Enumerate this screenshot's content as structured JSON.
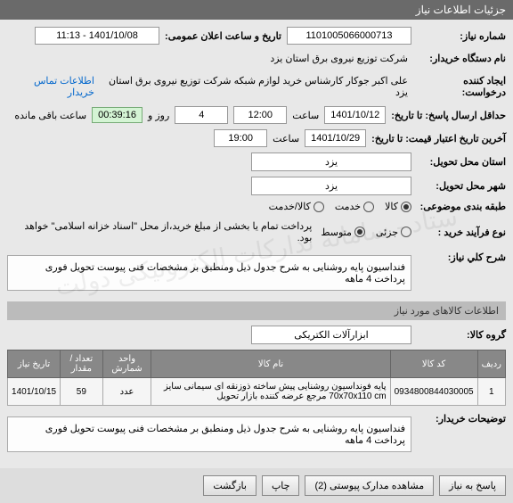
{
  "header": {
    "title": "جزئیات اطلاعات نیاز"
  },
  "fields": {
    "need_number_label": "شماره نیاز:",
    "need_number": "1101005066000713",
    "public_announce_label": "تاریخ و ساعت اعلان عمومی:",
    "public_announce": "1401/10/08 - 11:13",
    "buyer_org_label": "نام دستگاه خریدار:",
    "buyer_org": "شرکت توزیع نیروی برق استان یزد",
    "requester_label": "ایجاد کننده درخواست:",
    "requester": "علی اکبر جوکار  کارشناس خرید لوازم شبکه  شرکت توزیع نیروی برق استان یزد",
    "contact_link": "اطلاعات تماس خریدار",
    "deadline_label": "حداقل ارسال پاسخ: تا تاریخ:",
    "deadline_date": "1401/10/12",
    "saat_label": "ساعت",
    "deadline_time": "12:00",
    "days": "4",
    "days_label": "روز و",
    "timer": "00:39:16",
    "remaining_label": "ساعت باقی مانده",
    "validity_label": "آخرین تاریخ اعتبار قیمت: تا تاریخ:",
    "validity_date": "1401/10/29",
    "validity_time": "19:00",
    "delivery_province_label": "استان محل تحویل:",
    "delivery_province": "یزد",
    "delivery_city_label": "شهر محل تحویل:",
    "delivery_city": "یزد",
    "category_label": "طبقه بندی موضوعی:",
    "cat_goods": "کالا",
    "cat_service": "خدمت",
    "cat_both": "کالا/خدمت",
    "process_label": "نوع فرآیند خرید :",
    "proc_partial": "جزئی",
    "proc_medium": "متوسط",
    "payment_note": "پرداخت تمام یا بخشی از مبلغ خرید،از محل \"اسناد خزانه اسلامی\" خواهد بود.",
    "need_desc_label": "شرح کلي نیاز:",
    "need_desc": "فنداسیون پایه روشنایی به شرح جدول ذیل ومنطبق بر  مشخصات فنی پیوست تحویل فوری پرداخت 4 ماهه",
    "items_header": "اطلاعات کالاهای مورد نیاز",
    "goods_group_label": "گروه کالا:",
    "goods_group": "ابزارآلات الکتریکی",
    "buyer_notes_label": "توضیحات خریدار:",
    "buyer_notes": "فنداسیون پایه روشنایی به شرح جدول ذیل ومنطبق بر  مشخصات فنی پیوست تحویل فوری پرداخت 4 ماهه"
  },
  "table": {
    "headers": {
      "row": "ردیف",
      "code": "کد کالا",
      "name": "نام کالا",
      "unit": "واحد شمارش",
      "qty": "تعداد / مقدار",
      "date": "تاریخ نیاز"
    },
    "rows": [
      {
        "row": "1",
        "code": "0934800844030005",
        "name": "پایه فونداسیون روشنایی پیش ساخته ذوزنقه ای سیمانی سایز 70x70x110 cm مرجع عرضه کننده بازار تحویل",
        "unit": "عدد",
        "qty": "59",
        "date": "1401/10/15"
      }
    ]
  },
  "buttons": {
    "reply": "پاسخ به نیاز",
    "attachments": "مشاهده مدارک پیوستی (2)",
    "print": "چاپ",
    "back": "بازگشت"
  }
}
